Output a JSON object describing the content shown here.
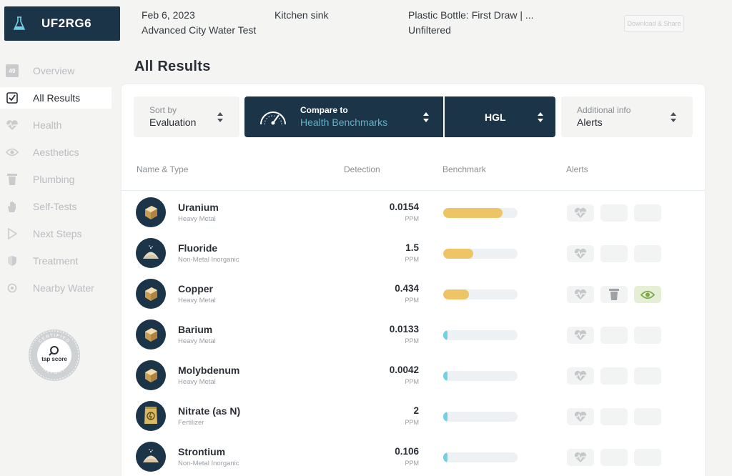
{
  "header": {
    "kit_id": "UF2RG6",
    "date": "Feb 6, 2023",
    "test_name": "Advanced City Water Test",
    "location": "Kitchen sink",
    "sample_type": "Plastic Bottle: First Draw | ...",
    "filter_status": "Unfiltered",
    "download_label": "Download & Share"
  },
  "sidebar": {
    "items": [
      {
        "label": "Overview",
        "icon": "count-badge",
        "badge": "49"
      },
      {
        "label": "All Results",
        "icon": "checkbox-icon"
      },
      {
        "label": "Health",
        "icon": "heartbeat-icon"
      },
      {
        "label": "Aesthetics",
        "icon": "eye-icon"
      },
      {
        "label": "Plumbing",
        "icon": "pipe-icon"
      },
      {
        "label": "Self-Tests",
        "icon": "hand-icon"
      },
      {
        "label": "Next Steps",
        "icon": "play-icon"
      },
      {
        "label": "Treatment",
        "icon": "shield-icon"
      },
      {
        "label": "Nearby Water",
        "icon": "location-icon"
      }
    ],
    "seal": {
      "top": "CERTIFIED",
      "brand": "tap score",
      "bottom": "REPORT"
    }
  },
  "main": {
    "title": "All Results",
    "controls": {
      "sort_label": "Sort by",
      "sort_value": "Evaluation",
      "compare_label": "Compare to",
      "compare_value": "Health Benchmarks",
      "benchmark_value": "HGL",
      "info_label": "Additional info",
      "info_value": "Alerts"
    },
    "columns": {
      "name": "Name & Type",
      "detection": "Detection",
      "benchmark": "Benchmark",
      "alerts": "Alerts"
    },
    "rows": [
      {
        "name": "Uranium",
        "type": "Heavy Metal",
        "value": "0.0154",
        "unit": "PPM",
        "benchmark_fraction": 0.8,
        "bar_color": "#edc566",
        "icon": "metal-cube-icon",
        "alerts": [
          "health"
        ]
      },
      {
        "name": "Fluoride",
        "type": "Non-Metal Inorganic",
        "value": "1.5",
        "unit": "PPM",
        "benchmark_fraction": 0.4,
        "bar_color": "#edc566",
        "icon": "powder-pile-icon",
        "alerts": [
          "health"
        ]
      },
      {
        "name": "Copper",
        "type": "Heavy Metal",
        "value": "0.434",
        "unit": "PPM",
        "benchmark_fraction": 0.35,
        "bar_color": "#edc566",
        "icon": "metal-cube-icon",
        "alerts": [
          "health",
          "plumbing",
          "aesthetics"
        ]
      },
      {
        "name": "Barium",
        "type": "Heavy Metal",
        "value": "0.0133",
        "unit": "PPM",
        "benchmark_fraction": 0.05,
        "bar_color": "#6fd0e6",
        "icon": "metal-cube-icon",
        "alerts": [
          "health"
        ]
      },
      {
        "name": "Molybdenum",
        "type": "Heavy Metal",
        "value": "0.0042",
        "unit": "PPM",
        "benchmark_fraction": 0.05,
        "bar_color": "#6fd0e6",
        "icon": "metal-cube-icon",
        "alerts": [
          "health"
        ]
      },
      {
        "name": "Nitrate (as N)",
        "type": "Fertilizer",
        "value": "2",
        "unit": "PPM",
        "benchmark_fraction": 0.05,
        "bar_color": "#6fd0e6",
        "icon": "fertilizer-bag-icon",
        "alerts": [
          "health"
        ]
      },
      {
        "name": "Strontium",
        "type": "Non-Metal Inorganic",
        "value": "0.106",
        "unit": "PPM",
        "benchmark_fraction": 0.05,
        "bar_color": "#6fd0e6",
        "icon": "powder-pile-icon",
        "alerts": [
          "health"
        ]
      }
    ]
  }
}
